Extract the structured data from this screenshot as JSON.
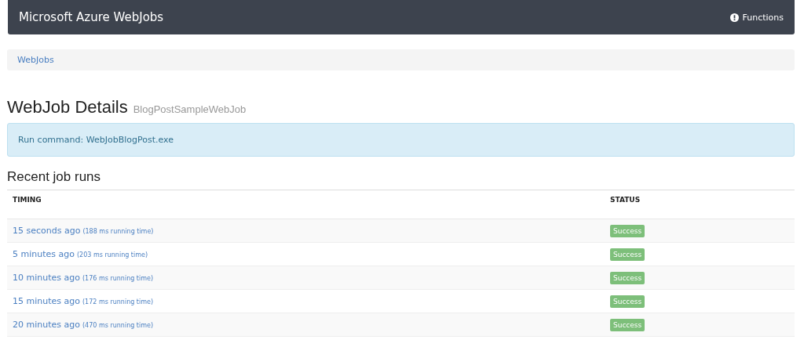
{
  "navbar": {
    "title": "Microsoft Azure WebJobs",
    "link": "Functions"
  },
  "breadcrumb": [
    "WebJobs"
  ],
  "heading": {
    "title": "WebJob Details",
    "subtitle": "BlogPostSampleWebJob"
  },
  "alert": {
    "text": "Run command: WebJobBlogPost.exe"
  },
  "section_title": "Recent job runs",
  "table": {
    "columns": [
      "TIMING",
      "STATUS"
    ],
    "rows": [
      {
        "time": "15 seconds ago",
        "duration": "(188 ms running time)",
        "status": "Success",
        "kind": "success"
      },
      {
        "time": "5 minutes ago",
        "duration": "(203 ms running time)",
        "status": "Success",
        "kind": "success"
      },
      {
        "time": "10 minutes ago",
        "duration": "(176 ms running time)",
        "status": "Success",
        "kind": "success"
      },
      {
        "time": "15 minutes ago",
        "duration": "(172 ms running time)",
        "status": "Success",
        "kind": "success"
      },
      {
        "time": "20 minutes ago",
        "duration": "(470 ms running time)",
        "status": "Success",
        "kind": "success"
      }
    ]
  }
}
